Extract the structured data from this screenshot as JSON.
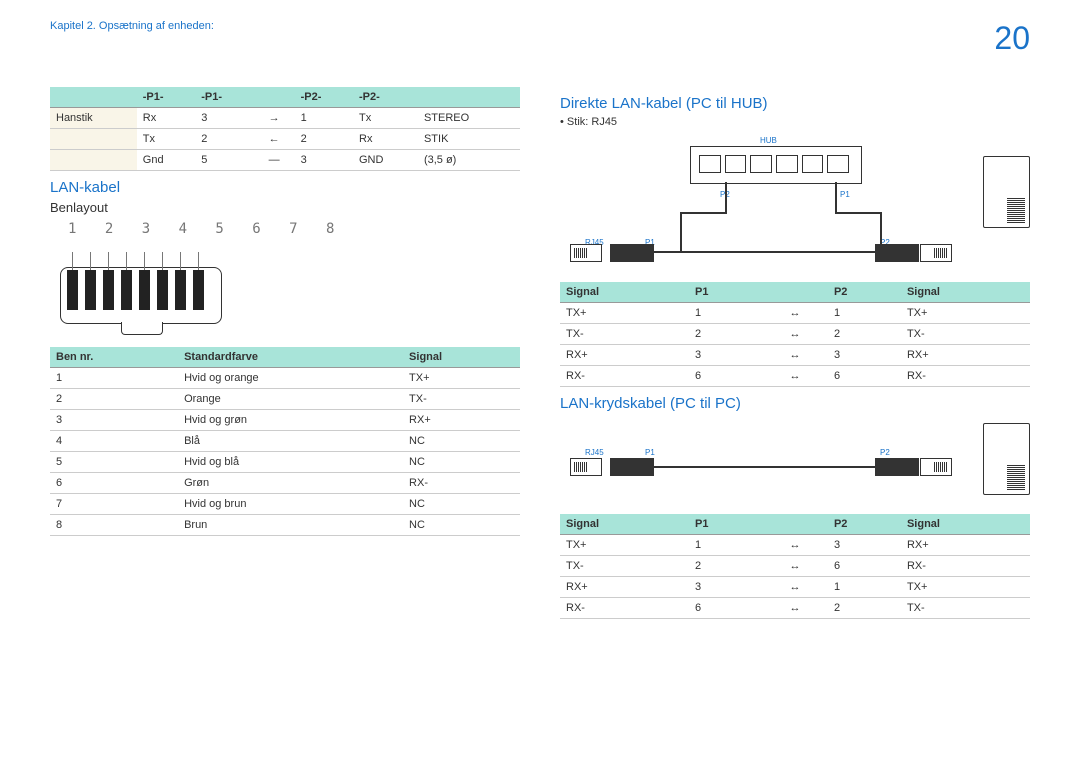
{
  "header": {
    "chapter": "Kapitel 2. Opsætning af enheden:",
    "page": "20"
  },
  "left": {
    "topTable": {
      "headers": [
        "-P1-",
        "-P1-",
        "",
        "-P2-",
        "-P2-",
        ""
      ],
      "rows": [
        [
          "Hanstik",
          "Rx",
          "3",
          "→",
          "1",
          "Tx",
          "STEREO"
        ],
        [
          "",
          "Tx",
          "2",
          "←",
          "2",
          "Rx",
          "STIK"
        ],
        [
          "",
          "Gnd",
          "5",
          "—",
          "3",
          "GND",
          "(3,5 ø)"
        ]
      ]
    },
    "section1": "LAN-kabel",
    "sub1": "Benlayout",
    "pins": "1 2 3 4 5 6 7 8",
    "colorTable": {
      "headers": [
        "Ben nr.",
        "Standardfarve",
        "Signal"
      ],
      "rows": [
        [
          "1",
          "Hvid og orange",
          "TX+"
        ],
        [
          "2",
          "Orange",
          "TX-"
        ],
        [
          "3",
          "Hvid og grøn",
          "RX+"
        ],
        [
          "4",
          "Blå",
          "NC"
        ],
        [
          "5",
          "Hvid og blå",
          "NC"
        ],
        [
          "6",
          "Grøn",
          "RX-"
        ],
        [
          "7",
          "Hvid og brun",
          "NC"
        ],
        [
          "8",
          "Brun",
          "NC"
        ]
      ]
    }
  },
  "right": {
    "section1": "Direkte LAN-kabel (PC til HUB)",
    "bullet1": "Stik: RJ45",
    "labels": {
      "hub": "HUB",
      "rj45": "RJ45",
      "p1": "P1",
      "p2": "P2"
    },
    "directTable": {
      "headers": [
        "Signal",
        "P1",
        "",
        "P2",
        "Signal"
      ],
      "rows": [
        [
          "TX+",
          "1",
          "↔",
          "1",
          "TX+"
        ],
        [
          "TX-",
          "2",
          "↔",
          "2",
          "TX-"
        ],
        [
          "RX+",
          "3",
          "↔",
          "3",
          "RX+"
        ],
        [
          "RX-",
          "6",
          "↔",
          "6",
          "RX-"
        ]
      ]
    },
    "section2": "LAN-krydskabel (PC til PC)",
    "crossTable": {
      "headers": [
        "Signal",
        "P1",
        "",
        "P2",
        "Signal"
      ],
      "rows": [
        [
          "TX+",
          "1",
          "↔",
          "3",
          "RX+"
        ],
        [
          "TX-",
          "2",
          "↔",
          "6",
          "RX-"
        ],
        [
          "RX+",
          "3",
          "↔",
          "1",
          "TX+"
        ],
        [
          "RX-",
          "6",
          "↔",
          "2",
          "TX-"
        ]
      ]
    }
  }
}
